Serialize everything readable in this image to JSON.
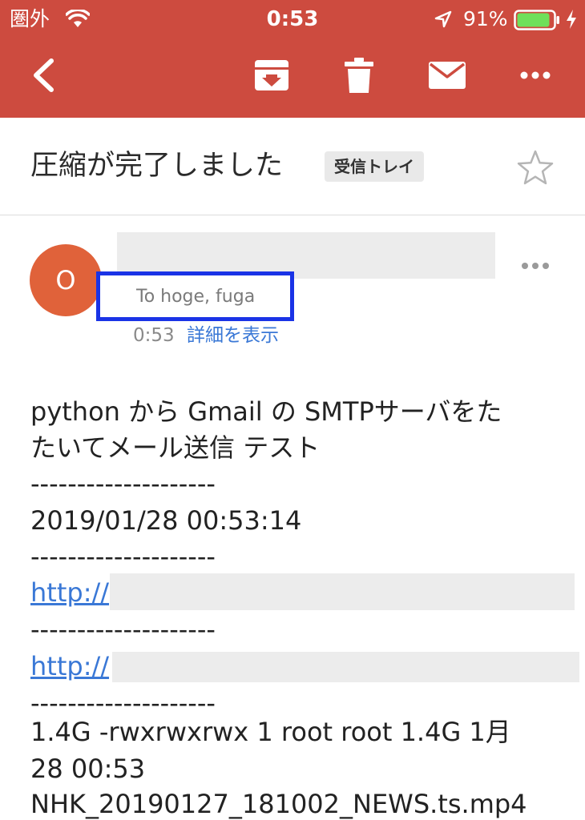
{
  "status_bar": {
    "carrier": "圏外",
    "time": "0:53",
    "battery_percent": "91%",
    "battery_level": 0.91,
    "accent_color": "#cd4b3f",
    "icons": [
      "wifi-icon",
      "location-arrow-icon",
      "battery-icon",
      "charging-bolt-icon"
    ]
  },
  "toolbar": {
    "icons": [
      "back-chevron-icon",
      "archive-icon",
      "trash-icon",
      "mail-icon",
      "more-horizontal-icon"
    ]
  },
  "message": {
    "subject": "圧縮が完了しました",
    "label": "受信トレイ",
    "avatar_initial": "O",
    "avatar_color": "#e0623a",
    "recipients": "To hoge, fuga",
    "time": "0:53",
    "details_link": "詳細を表示"
  },
  "body": {
    "line1": "python から Gmail の SMTPサーバをた",
    "line2": "たいてメール送信 テスト",
    "separator": "--------------------",
    "timestamp": "2019/01/28 00:53:14",
    "link1": "http://",
    "link2": "http://",
    "file_line1": "1.4G -rwxrwxrwx 1 root root 1.4G  1月",
    "file_line2": "28 00:53",
    "file_line3": "NHK_20190127_181002_NEWS.ts.mp4"
  }
}
